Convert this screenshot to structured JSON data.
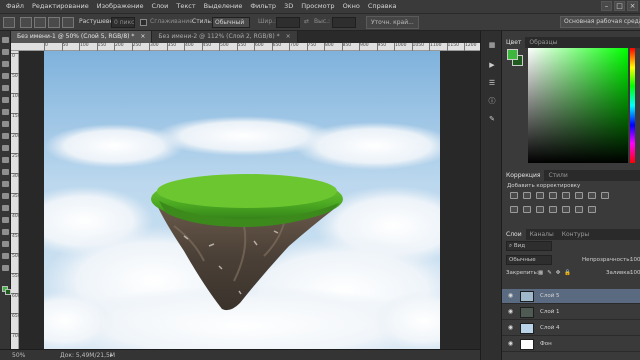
{
  "menu": [
    "Файл",
    "Редактирование",
    "Изображение",
    "Слои",
    "Текст",
    "Выделение",
    "Фильтр",
    "3D",
    "Просмотр",
    "Окно",
    "Справка"
  ],
  "window_controls": [
    "–",
    "□",
    "×"
  ],
  "options": {
    "feather_label": "Растушевка:",
    "feather_value": "0 пикс.",
    "antialias_label": "Сглаживание",
    "style_label": "Стиль:",
    "style_value": "Обычный",
    "width_label": "Шир.:",
    "height_label": "Выс.:",
    "refine_button": "Уточн. край...",
    "workspace": "Основная рабочая среда"
  },
  "tabs": [
    {
      "label": "Без имени-1 @ 50% (Слой 5, RGB/8) *",
      "close": "×"
    },
    {
      "label": "Без имени-2 @ 112% (Слой 2, RGB/8) *",
      "close": "×"
    }
  ],
  "ruler_top": [
    "0",
    "50",
    "100",
    "150",
    "200",
    "250",
    "300",
    "350",
    "400",
    "450",
    "500",
    "550",
    "600",
    "650",
    "700",
    "750",
    "800",
    "850",
    "900",
    "950",
    "1000",
    "1050",
    "1100",
    "1150",
    "1200"
  ],
  "ruler_left": [
    "0",
    "50",
    "100",
    "150",
    "200",
    "250",
    "300",
    "350",
    "400",
    "450",
    "500",
    "550",
    "600",
    "650",
    "700"
  ],
  "status": {
    "zoom": "50%",
    "doc": "Док: 5,49M/21,5M"
  },
  "color_panel": {
    "tabs": [
      "Цвет",
      "Образцы"
    ]
  },
  "adjustments": {
    "tabs": [
      "Коррекция",
      "Стили"
    ],
    "title": "Добавить корректировку"
  },
  "layers_panel": {
    "tabs": [
      "Слои",
      "Каналы",
      "Контуры"
    ],
    "filter_value": "Вид",
    "blend_mode": "Обычные",
    "opacity_label": "Непрозрачность:",
    "opacity_value": "100%",
    "lock_label": "Закрепить:",
    "fill_label": "Заливка:",
    "fill_value": "100%",
    "layers": [
      {
        "name": "Слой 5",
        "selected": true
      },
      {
        "name": "Слой 1",
        "selected": false
      },
      {
        "name": "Слой 4",
        "selected": false
      },
      {
        "name": "Фон",
        "selected": false
      }
    ]
  },
  "colors": {
    "foreground": "#3cb83c",
    "background": "#1f5a1f",
    "accent": "#5a6a80"
  },
  "icons": [
    "move-icon",
    "marquee-icon",
    "lasso-icon",
    "quick-select-icon",
    "crop-icon",
    "eyedropper-icon",
    "healing-icon",
    "brush-icon",
    "stamp-icon",
    "history-brush-icon",
    "eraser-icon",
    "gradient-icon",
    "blur-icon",
    "dodge-icon",
    "pen-icon",
    "type-icon",
    "path-select-icon",
    "shape-icon",
    "hand-icon",
    "zoom-icon"
  ]
}
